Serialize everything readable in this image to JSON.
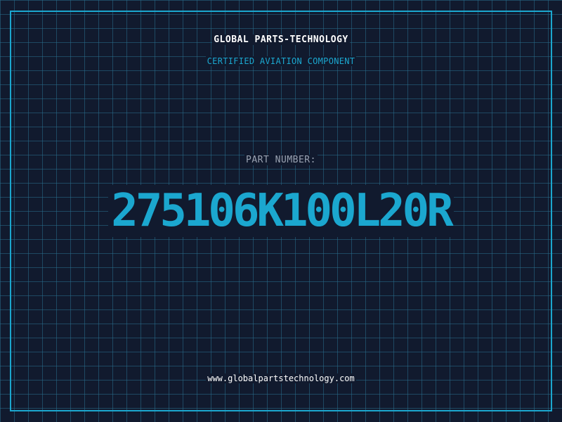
{
  "header": {
    "company_name": "GLOBAL PARTS-TECHNOLOGY",
    "tagline": "CERTIFIED AVIATION COMPONENT"
  },
  "part": {
    "label": "PART NUMBER:",
    "number": "275106K100L20R"
  },
  "footer": {
    "website": "www.globalpartstechnology.com"
  },
  "colors": {
    "background": "#111a2e",
    "grid": "#286e8c",
    "accent": "#1ba7cf",
    "text_primary": "#ffffff",
    "text_muted": "#9aa3b2"
  }
}
